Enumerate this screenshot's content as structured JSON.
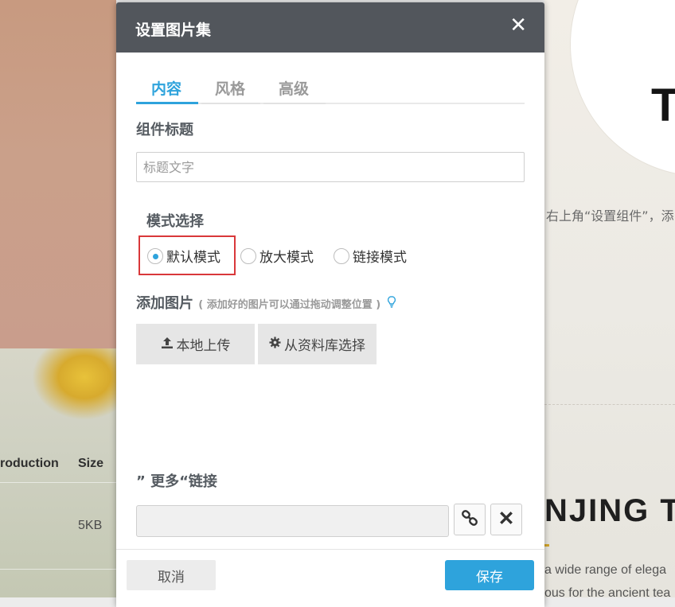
{
  "modal": {
    "title": "设置图片集",
    "close_glyph": "✕"
  },
  "tabs": [
    {
      "label": "内容",
      "active": true
    },
    {
      "label": "风格",
      "active": false
    },
    {
      "label": "高级",
      "active": false
    }
  ],
  "component_title": {
    "label": "组件标题",
    "placeholder": "标题文字",
    "value": ""
  },
  "mode": {
    "label": "模式选择",
    "options": [
      {
        "label": "默认模式",
        "checked": true
      },
      {
        "label": "放大模式",
        "checked": false
      },
      {
        "label": "链接模式",
        "checked": false
      }
    ]
  },
  "add_images": {
    "label": "添加图片",
    "hint": "( 添加好的图片可以通过拖动调整位置 )",
    "local_upload": "本地上传",
    "library_select": "从资料库选择"
  },
  "more_link": {
    "label": "” 更多“链接",
    "value": ""
  },
  "footer": {
    "cancel": "取消",
    "save": "保存"
  },
  "background": {
    "table_header_1": "roduction",
    "table_header_2": "Size",
    "table_cell": "5KB",
    "big_letter": "T",
    "right_text": "右上角“设置组件”，添",
    "heading": "NJING T",
    "para_line_1": "a wide range of elega",
    "para_line_2": "ous for the ancient tea"
  },
  "colors": {
    "accent": "#2ea3dc",
    "header_bg": "#52565c",
    "highlight": "#d9383a"
  }
}
